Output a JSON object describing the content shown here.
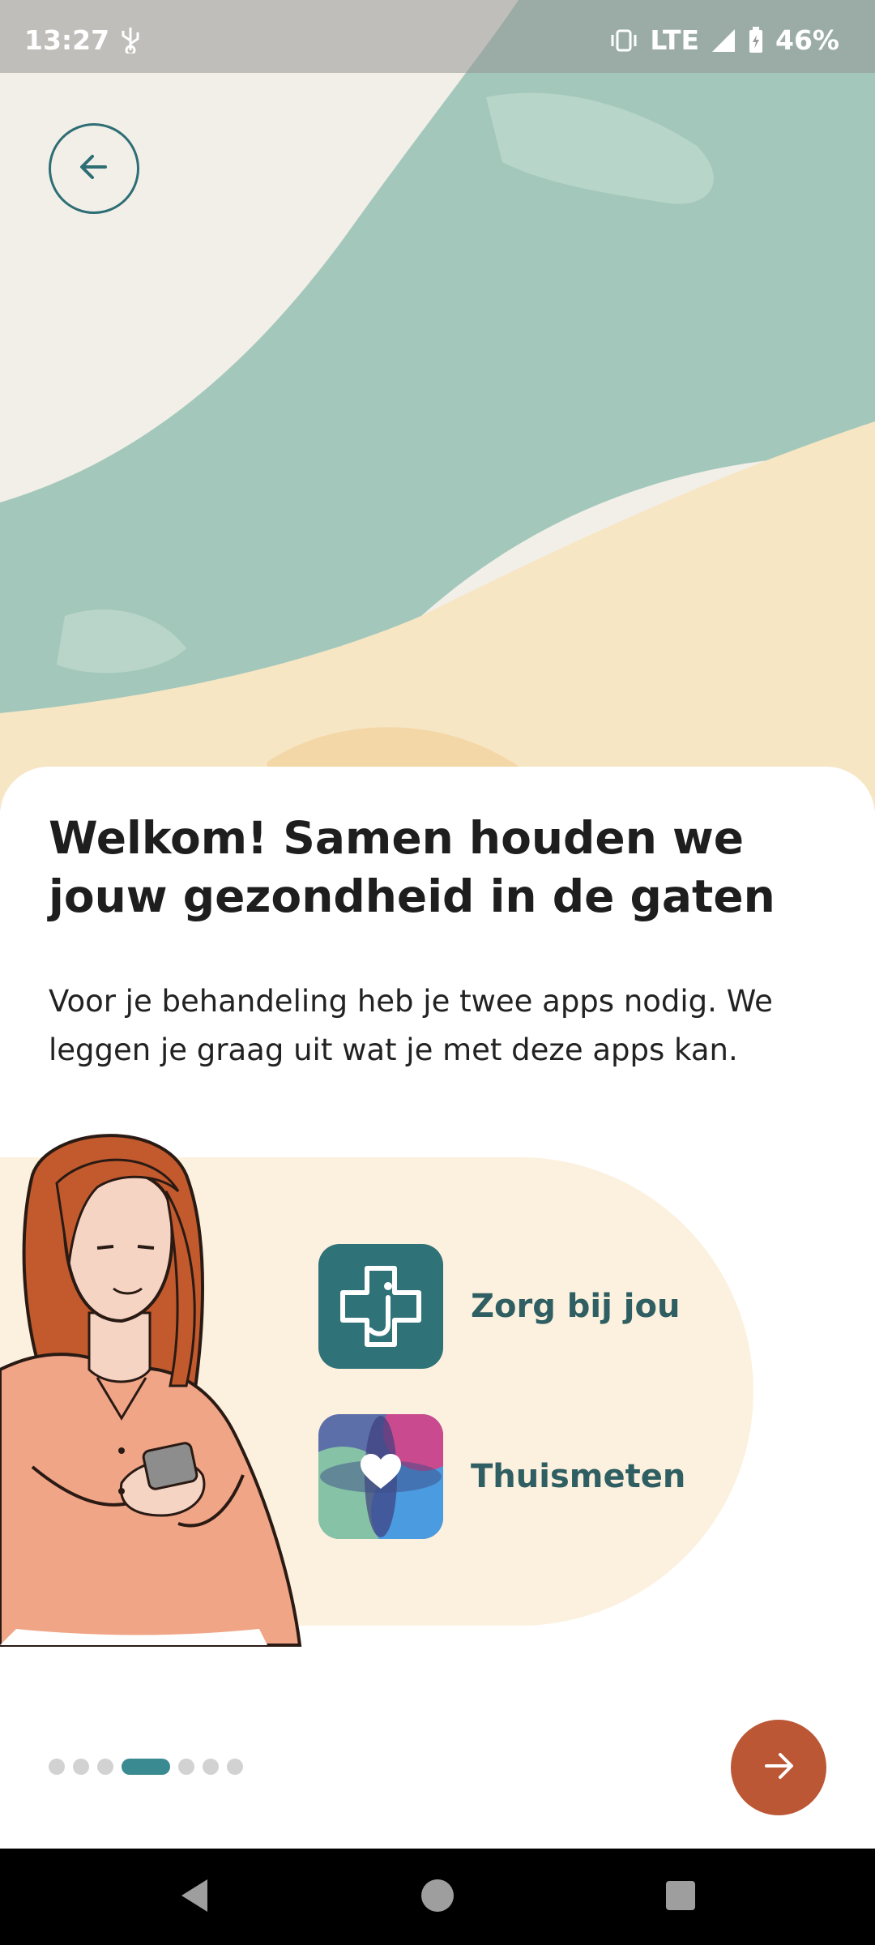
{
  "status_bar": {
    "time": "13:27",
    "network": "LTE",
    "battery": "46%"
  },
  "welcome": {
    "title": "Welkom! Samen houden we jouw gezondheid in de gaten",
    "body": "Voor je behandeling heb je twee apps nodig. We leggen je graag uit wat je met deze apps kan."
  },
  "apps": [
    {
      "name": "Zorg bij jou",
      "icon": "zorg-bij-jou-app-icon"
    },
    {
      "name": "Thuismeten",
      "icon": "thuismeten-app-icon"
    }
  ],
  "pager": {
    "total_pages": 7,
    "current_page": 4
  },
  "colors": {
    "accent": "#2d6e74",
    "next_button": "#bb5734",
    "panel": "#fcf1de"
  }
}
